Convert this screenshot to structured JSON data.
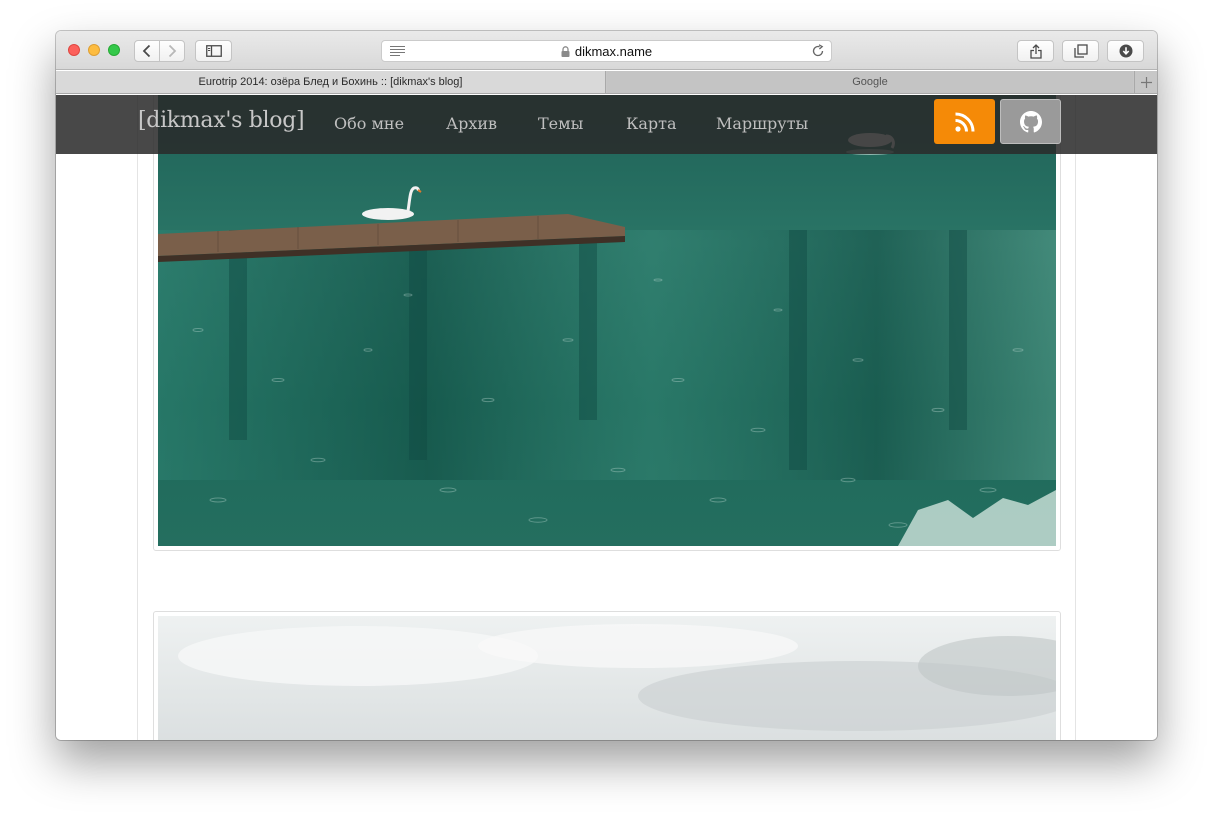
{
  "browser": {
    "url": "dikmax.name",
    "tabs": [
      {
        "label": "Eurotrip 2014: озёра Блед и Бохинь :: [dikmax's blog]",
        "active": true
      },
      {
        "label": "Google",
        "active": false
      }
    ],
    "icons": {
      "back": "chevron-left-icon",
      "forward": "chevron-right-icon",
      "sidebar": "sidebar-icon",
      "reader": "reader-icon",
      "lock": "lock-icon",
      "reload": "reload-icon",
      "share": "share-icon",
      "tabs": "tabs-overview-icon",
      "downloads": "download-icon",
      "new_tab": "plus-icon"
    }
  },
  "site": {
    "brand": "[dikmax's blog]",
    "nav": [
      "Обо мне",
      "Архив",
      "Темы",
      "Карта",
      "Маршруты"
    ],
    "rss_icon": "rss-icon",
    "github_icon": "github-icon",
    "colors": {
      "navbar": "#2a2a2a",
      "rss": "#f58a07",
      "github": "#9a9a9a"
    }
  },
  "content": {
    "photos": [
      {
        "subject": "lake-with-swans-and-pier"
      },
      {
        "subject": "misty-sky"
      }
    ]
  }
}
